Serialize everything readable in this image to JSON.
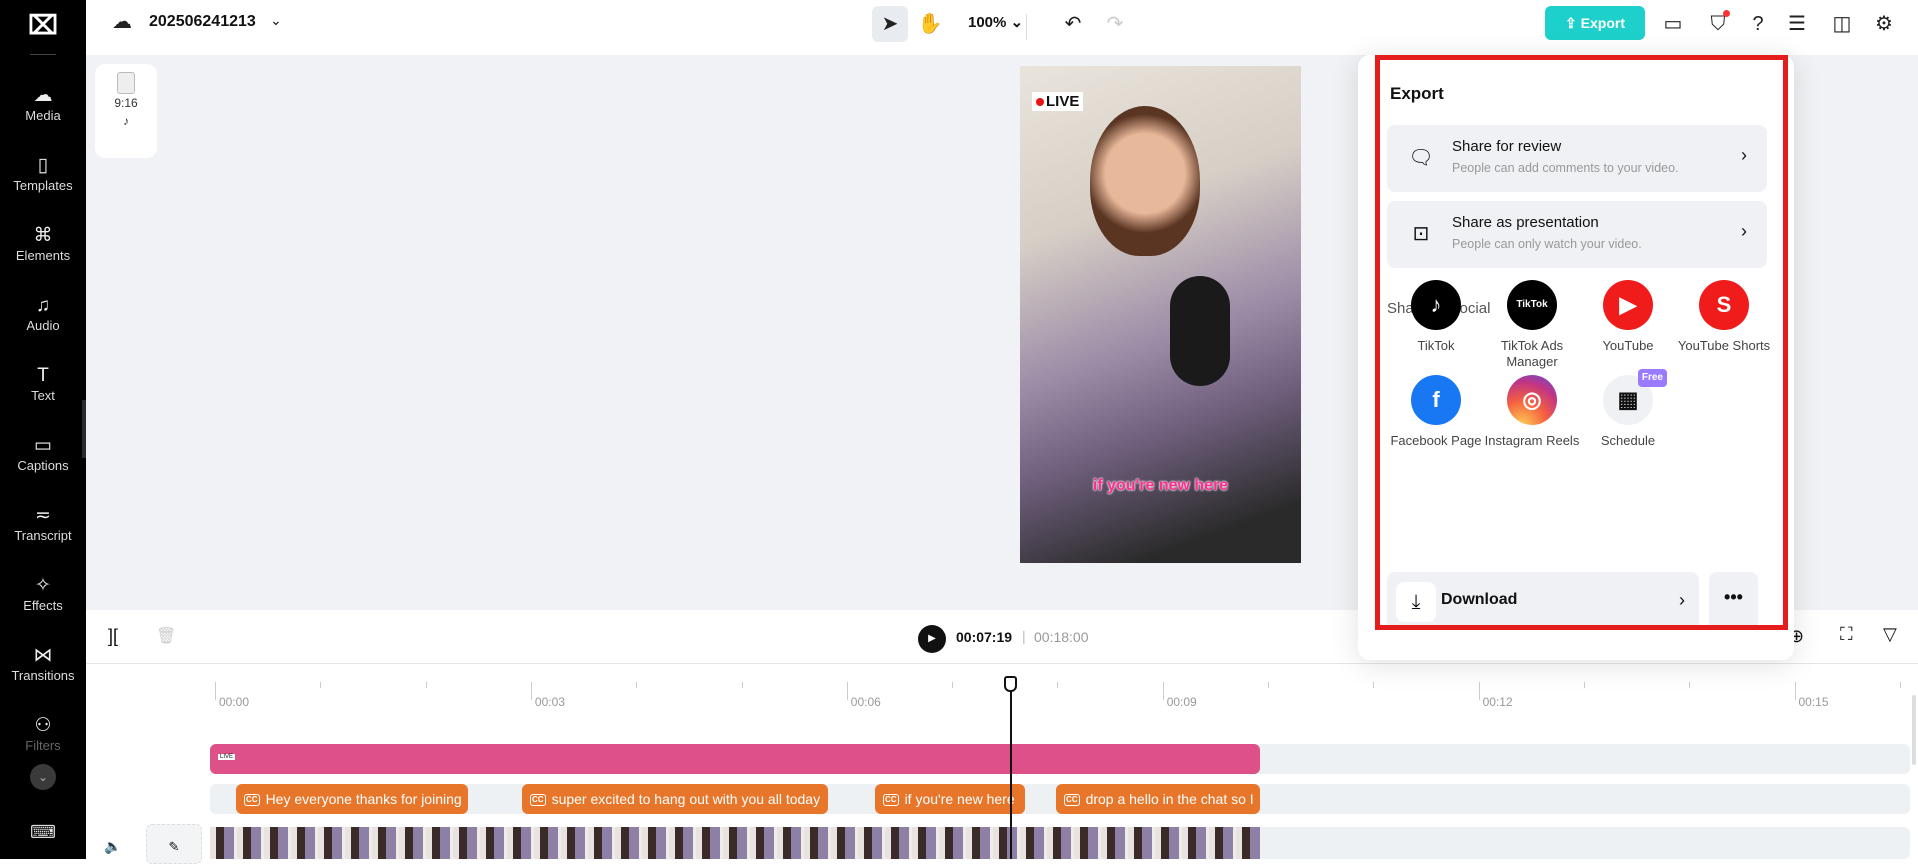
{
  "topbar": {
    "project_name": "202506241213",
    "zoom": "100%",
    "export_label": "Export"
  },
  "sidebar": {
    "items": [
      {
        "label": "Media",
        "icon": "☁"
      },
      {
        "label": "Templates",
        "icon": "▯"
      },
      {
        "label": "Elements",
        "icon": "⌘"
      },
      {
        "label": "Audio",
        "icon": "♫"
      },
      {
        "label": "Text",
        "icon": "T"
      },
      {
        "label": "Captions",
        "icon": "▭"
      },
      {
        "label": "Transcript",
        "icon": "≂"
      },
      {
        "label": "Effects",
        "icon": "✧"
      },
      {
        "label": "Transitions",
        "icon": "⋈"
      },
      {
        "label": "Filters",
        "icon": "⚇"
      }
    ]
  },
  "canvas": {
    "aspect_ratio": "9:16",
    "video_badge": "LIVE",
    "video_caption": "if you're new here"
  },
  "export_panel": {
    "title": "Export",
    "share_review": {
      "title": "Share for review",
      "subtitle": "People can add comments to your video."
    },
    "share_presentation": {
      "title": "Share as presentation",
      "subtitle": "People can only watch your video."
    },
    "social_heading": "Share on social",
    "social": [
      {
        "label": "TikTok",
        "color": "#000000"
      },
      {
        "label": "TikTok Ads Manager",
        "color": "#000000",
        "logo_text": "TikTok"
      },
      {
        "label": "YouTube",
        "color": "#f01c1c"
      },
      {
        "label": "YouTube Shorts",
        "color": "#f01c1c"
      },
      {
        "label": "Facebook Page",
        "color": "#1877f2"
      },
      {
        "label": "Instagram Reels",
        "color": "#d62976"
      },
      {
        "label": "Schedule",
        "color": "#eff1f4",
        "badge": "Free"
      }
    ],
    "download_label": "Download"
  },
  "player": {
    "current": "00:07:19",
    "separator": "|",
    "total": "00:18:00"
  },
  "timeline": {
    "ruler": [
      "00:00",
      "00:03",
      "00:06",
      "00:09",
      "00:12",
      "00:15"
    ],
    "sticker_label": "LIVE",
    "captions": [
      "Hey everyone thanks for joining",
      "super excited to hang out with you all today",
      "if you're new here",
      "drop a hello in the chat so I"
    ]
  },
  "colors": {
    "accent": "#1ed0cb",
    "caption_clip": "#e8762a",
    "sticker_clip": "#dd5088",
    "highlight": "#e51c1c"
  }
}
